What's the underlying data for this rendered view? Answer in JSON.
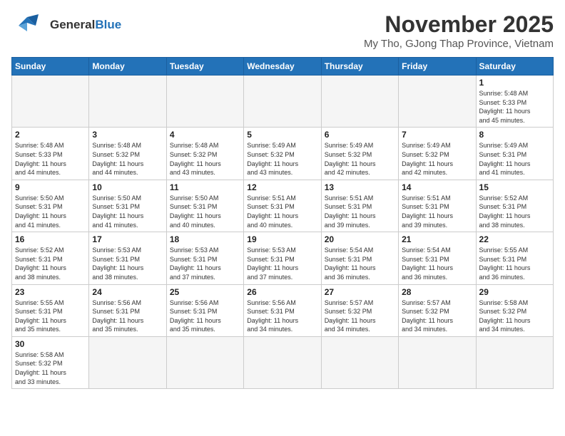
{
  "header": {
    "logo_general": "General",
    "logo_blue": "Blue",
    "month_title": "November 2025",
    "subtitle": "My Tho, GJong Thap Province, Vietnam"
  },
  "days_of_week": [
    "Sunday",
    "Monday",
    "Tuesday",
    "Wednesday",
    "Thursday",
    "Friday",
    "Saturday"
  ],
  "weeks": [
    [
      {
        "day": "",
        "info": ""
      },
      {
        "day": "",
        "info": ""
      },
      {
        "day": "",
        "info": ""
      },
      {
        "day": "",
        "info": ""
      },
      {
        "day": "",
        "info": ""
      },
      {
        "day": "",
        "info": ""
      },
      {
        "day": "1",
        "info": "Sunrise: 5:48 AM\nSunset: 5:33 PM\nDaylight: 11 hours\nand 45 minutes."
      }
    ],
    [
      {
        "day": "2",
        "info": "Sunrise: 5:48 AM\nSunset: 5:33 PM\nDaylight: 11 hours\nand 44 minutes."
      },
      {
        "day": "3",
        "info": "Sunrise: 5:48 AM\nSunset: 5:32 PM\nDaylight: 11 hours\nand 44 minutes."
      },
      {
        "day": "4",
        "info": "Sunrise: 5:48 AM\nSunset: 5:32 PM\nDaylight: 11 hours\nand 43 minutes."
      },
      {
        "day": "5",
        "info": "Sunrise: 5:49 AM\nSunset: 5:32 PM\nDaylight: 11 hours\nand 43 minutes."
      },
      {
        "day": "6",
        "info": "Sunrise: 5:49 AM\nSunset: 5:32 PM\nDaylight: 11 hours\nand 42 minutes."
      },
      {
        "day": "7",
        "info": "Sunrise: 5:49 AM\nSunset: 5:32 PM\nDaylight: 11 hours\nand 42 minutes."
      },
      {
        "day": "8",
        "info": "Sunrise: 5:49 AM\nSunset: 5:31 PM\nDaylight: 11 hours\nand 41 minutes."
      }
    ],
    [
      {
        "day": "9",
        "info": "Sunrise: 5:50 AM\nSunset: 5:31 PM\nDaylight: 11 hours\nand 41 minutes."
      },
      {
        "day": "10",
        "info": "Sunrise: 5:50 AM\nSunset: 5:31 PM\nDaylight: 11 hours\nand 41 minutes."
      },
      {
        "day": "11",
        "info": "Sunrise: 5:50 AM\nSunset: 5:31 PM\nDaylight: 11 hours\nand 40 minutes."
      },
      {
        "day": "12",
        "info": "Sunrise: 5:51 AM\nSunset: 5:31 PM\nDaylight: 11 hours\nand 40 minutes."
      },
      {
        "day": "13",
        "info": "Sunrise: 5:51 AM\nSunset: 5:31 PM\nDaylight: 11 hours\nand 39 minutes."
      },
      {
        "day": "14",
        "info": "Sunrise: 5:51 AM\nSunset: 5:31 PM\nDaylight: 11 hours\nand 39 minutes."
      },
      {
        "day": "15",
        "info": "Sunrise: 5:52 AM\nSunset: 5:31 PM\nDaylight: 11 hours\nand 38 minutes."
      }
    ],
    [
      {
        "day": "16",
        "info": "Sunrise: 5:52 AM\nSunset: 5:31 PM\nDaylight: 11 hours\nand 38 minutes."
      },
      {
        "day": "17",
        "info": "Sunrise: 5:53 AM\nSunset: 5:31 PM\nDaylight: 11 hours\nand 38 minutes."
      },
      {
        "day": "18",
        "info": "Sunrise: 5:53 AM\nSunset: 5:31 PM\nDaylight: 11 hours\nand 37 minutes."
      },
      {
        "day": "19",
        "info": "Sunrise: 5:53 AM\nSunset: 5:31 PM\nDaylight: 11 hours\nand 37 minutes."
      },
      {
        "day": "20",
        "info": "Sunrise: 5:54 AM\nSunset: 5:31 PM\nDaylight: 11 hours\nand 36 minutes."
      },
      {
        "day": "21",
        "info": "Sunrise: 5:54 AM\nSunset: 5:31 PM\nDaylight: 11 hours\nand 36 minutes."
      },
      {
        "day": "22",
        "info": "Sunrise: 5:55 AM\nSunset: 5:31 PM\nDaylight: 11 hours\nand 36 minutes."
      }
    ],
    [
      {
        "day": "23",
        "info": "Sunrise: 5:55 AM\nSunset: 5:31 PM\nDaylight: 11 hours\nand 35 minutes."
      },
      {
        "day": "24",
        "info": "Sunrise: 5:56 AM\nSunset: 5:31 PM\nDaylight: 11 hours\nand 35 minutes."
      },
      {
        "day": "25",
        "info": "Sunrise: 5:56 AM\nSunset: 5:31 PM\nDaylight: 11 hours\nand 35 minutes."
      },
      {
        "day": "26",
        "info": "Sunrise: 5:56 AM\nSunset: 5:31 PM\nDaylight: 11 hours\nand 34 minutes."
      },
      {
        "day": "27",
        "info": "Sunrise: 5:57 AM\nSunset: 5:32 PM\nDaylight: 11 hours\nand 34 minutes."
      },
      {
        "day": "28",
        "info": "Sunrise: 5:57 AM\nSunset: 5:32 PM\nDaylight: 11 hours\nand 34 minutes."
      },
      {
        "day": "29",
        "info": "Sunrise: 5:58 AM\nSunset: 5:32 PM\nDaylight: 11 hours\nand 34 minutes."
      }
    ],
    [
      {
        "day": "30",
        "info": "Sunrise: 5:58 AM\nSunset: 5:32 PM\nDaylight: 11 hours\nand 33 minutes."
      },
      {
        "day": "",
        "info": ""
      },
      {
        "day": "",
        "info": ""
      },
      {
        "day": "",
        "info": ""
      },
      {
        "day": "",
        "info": ""
      },
      {
        "day": "",
        "info": ""
      },
      {
        "day": "",
        "info": ""
      }
    ]
  ]
}
